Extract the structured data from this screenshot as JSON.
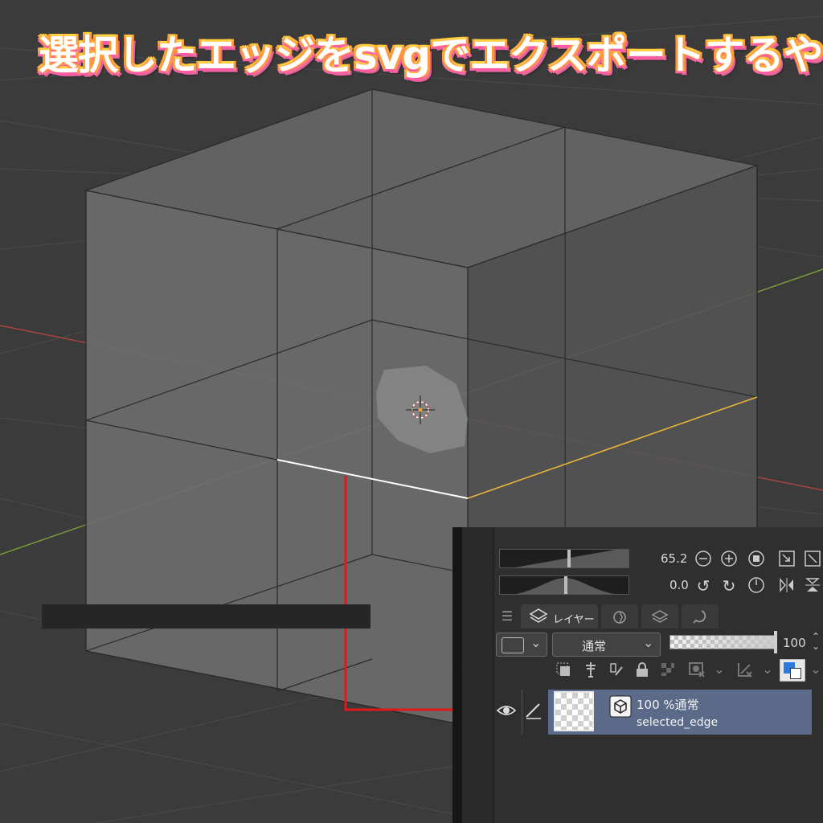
{
  "title": "選択したエッジをsvgでエクスポートするやつ",
  "panel": {
    "brush_size_value": "65.2",
    "rotation_value": "0.0",
    "tab_label": "レイヤー",
    "blend_mode": "通常",
    "opacity_value": "100",
    "layer": {
      "info": "100 %通常",
      "name": "selected_edge"
    }
  },
  "colors": {
    "background": "#3b3b3b",
    "cube_face": "#6b6b6b",
    "selected_edge": "#ffffff",
    "adjacent_edge": "#f0b83a",
    "x_axis": "#b04444",
    "y_axis": "#7a9a3a",
    "arrow": "#e01a1a",
    "layer_selected": "#5a6a88"
  }
}
